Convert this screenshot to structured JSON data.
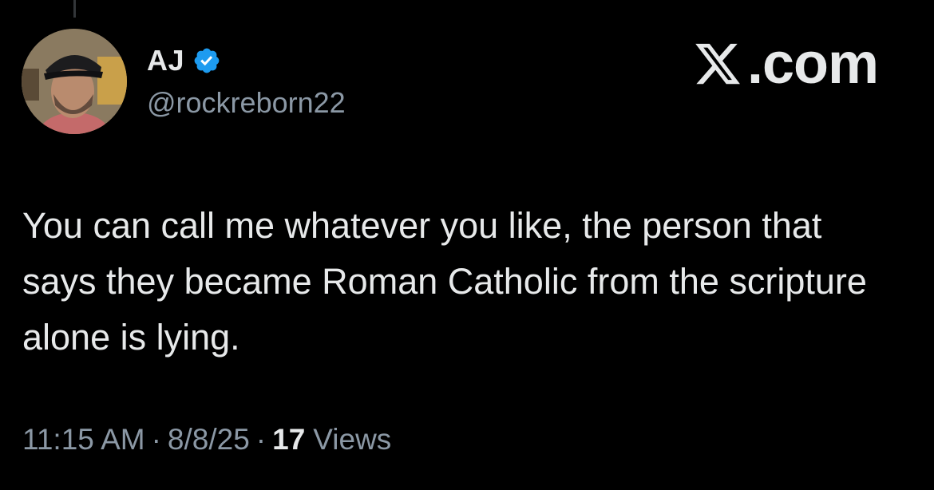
{
  "author": {
    "display_name": "AJ",
    "handle": "@rockreborn22",
    "verified": true,
    "verified_color": "#1d9bf0"
  },
  "brand": {
    "text": ".com",
    "icon": "x-logo-icon"
  },
  "tweet": {
    "text": "You can call me whatever you like, the person that says they became Roman Catholic from the scripture alone is lying."
  },
  "meta": {
    "time": "11:15 AM",
    "separator": "·",
    "date": "8/8/25",
    "views_count": "17",
    "views_label": "Views"
  },
  "colors": {
    "background": "#000000",
    "text_primary": "#e7e9ea",
    "text_secondary": "#8b98a5"
  }
}
